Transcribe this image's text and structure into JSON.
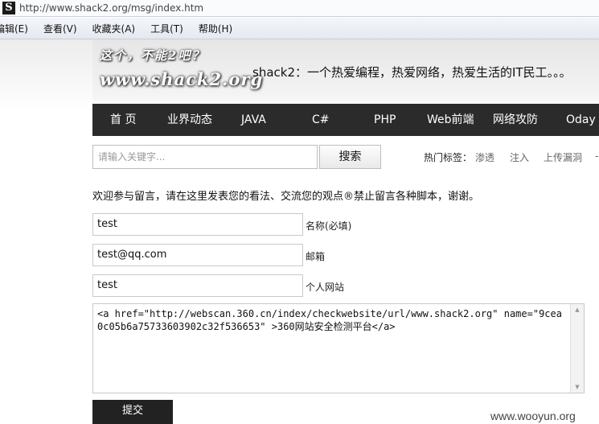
{
  "browser": {
    "url": "http://www.shack2.org/msg/index.htm",
    "favicon_letter": "S",
    "menu": [
      "编辑(E)",
      "查看(V)",
      "收藏夹(A)",
      "工具(T)",
      "帮助(H)"
    ]
  },
  "header": {
    "logo_line1": "这个，不能2吧？",
    "logo_line2": "www.shack2.org",
    "slogan": "shack2：一个热爱编程，热爱网络，热爱生活的IT民工。。。"
  },
  "nav": {
    "items": [
      "首 页",
      "业界动态",
      "JAVA",
      "C#",
      "PHP",
      "Web前端",
      "网络攻防",
      "Oday"
    ]
  },
  "search": {
    "placeholder": "请输入关键字...",
    "button_label": "搜索",
    "hot_label": "热门标签：",
    "hot_tags": [
      "渗透",
      "注入",
      "上传漏洞",
      "‑"
    ]
  },
  "form": {
    "intro": "欢迎参与留言，请在这里发表您的看法、交流您的观点®禁止留言各种脚本，谢谢。",
    "name_value": "test",
    "name_label": "名称(必填)",
    "email_value": "test@qq.com",
    "email_label": "邮箱",
    "site_value": "test",
    "site_label": "个人网站",
    "message_value": "<a href=\"http://webscan.360.cn/index/checkwebsite/url/www.shack2.org\" name=\"9cea0c05b6a75733603902c32f536653\" >360网站安全检测平台</a>",
    "submit_label": "提交"
  },
  "watermark": "www.wooyun.org"
}
